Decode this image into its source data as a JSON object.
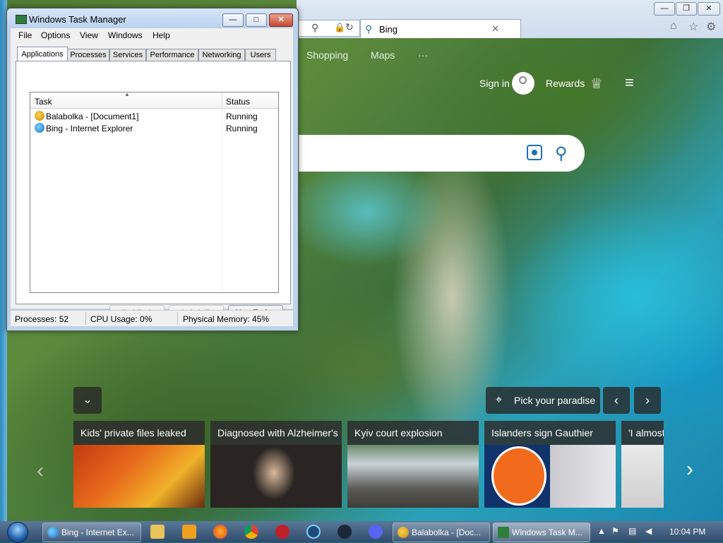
{
  "task_manager": {
    "title": "Windows Task Manager",
    "menu": [
      "File",
      "Options",
      "View",
      "Windows",
      "Help"
    ],
    "tabs": [
      "Applications",
      "Processes",
      "Services",
      "Performance",
      "Networking",
      "Users"
    ],
    "columns": {
      "task": "Task",
      "status": "Status"
    },
    "rows": [
      {
        "name": "Balabolka - [Document1]",
        "status": "Running",
        "icon": "balabolka-icon"
      },
      {
        "name": "Bing - Internet Explorer",
        "status": "Running",
        "icon": "ie-icon"
      }
    ],
    "buttons": {
      "end_task": "End Task",
      "switch_to": "Switch To",
      "new_task": "New Task..."
    },
    "status": {
      "processes": "Processes: 52",
      "cpu": "CPU Usage: 0%",
      "memory": "Physical Memory: 45%"
    }
  },
  "browser": {
    "tab_title": "Bing",
    "bing": {
      "nav": [
        "Shopping",
        "Maps",
        "···"
      ],
      "sign_in": "Sign in",
      "rewards": "Rewards",
      "pick_paradise": "Pick your paradise",
      "news": [
        {
          "caption": "Kids' private files leaked"
        },
        {
          "caption": "Diagnosed with Alzheimer's"
        },
        {
          "caption": "Kyiv court explosion"
        },
        {
          "caption": "Islanders sign Gauthier"
        },
        {
          "caption": "'I almost"
        }
      ]
    }
  },
  "taskbar": {
    "items": [
      {
        "label": "Bing - Internet Ex...",
        "icon": "ie-icon"
      },
      {
        "label": "Balabolka - [Doc...",
        "icon": "balabolka-icon"
      },
      {
        "label": "Windows Task M...",
        "icon": "task-manager-icon"
      }
    ],
    "clock": "10:04 PM"
  },
  "colors": {
    "accent": "#1e6fb8",
    "taskbar": "#2f4c6c"
  }
}
